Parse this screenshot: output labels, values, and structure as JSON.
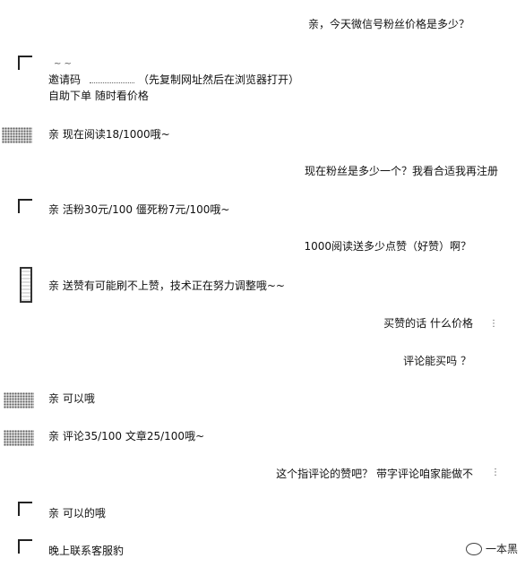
{
  "messages": [
    {
      "side": "right",
      "text": "亲，今天微信号粉丝价格是多少？"
    },
    {
      "side": "left",
      "text": "邀请码"
    },
    {
      "side": "left",
      "text": "（先复制网址然后在浏览器打开）"
    },
    {
      "side": "left",
      "text": "自助下单  随时看价格"
    },
    {
      "side": "left",
      "text": "亲  现在阅读18/1000哦~"
    },
    {
      "side": "right",
      "text": "现在粉丝是多少一个？我看合适我再注册"
    },
    {
      "side": "left",
      "text": "亲  活粉30元/100    僵死粉7元/100哦~"
    },
    {
      "side": "right",
      "text": "1000阅读送多少点赞（好赞）啊？"
    },
    {
      "side": "left",
      "text": "亲  送赞有可能刷不上赞，技术正在努力调整哦~~"
    },
    {
      "side": "right",
      "text": "买赞的话 什么价格"
    },
    {
      "side": "right",
      "text": "评论能买吗 ？"
    },
    {
      "side": "left",
      "text": "亲  可以哦"
    },
    {
      "side": "left",
      "text": "亲  评论35/100    文章25/100哦~"
    },
    {
      "side": "right",
      "text": "这个指评论的赞吧？  带字评论咱家能做不"
    },
    {
      "side": "left",
      "text": "亲  可以的哦"
    },
    {
      "side": "left",
      "text": "晚上联系客服豹"
    }
  ],
  "watermark": {
    "text": "一本黑"
  }
}
